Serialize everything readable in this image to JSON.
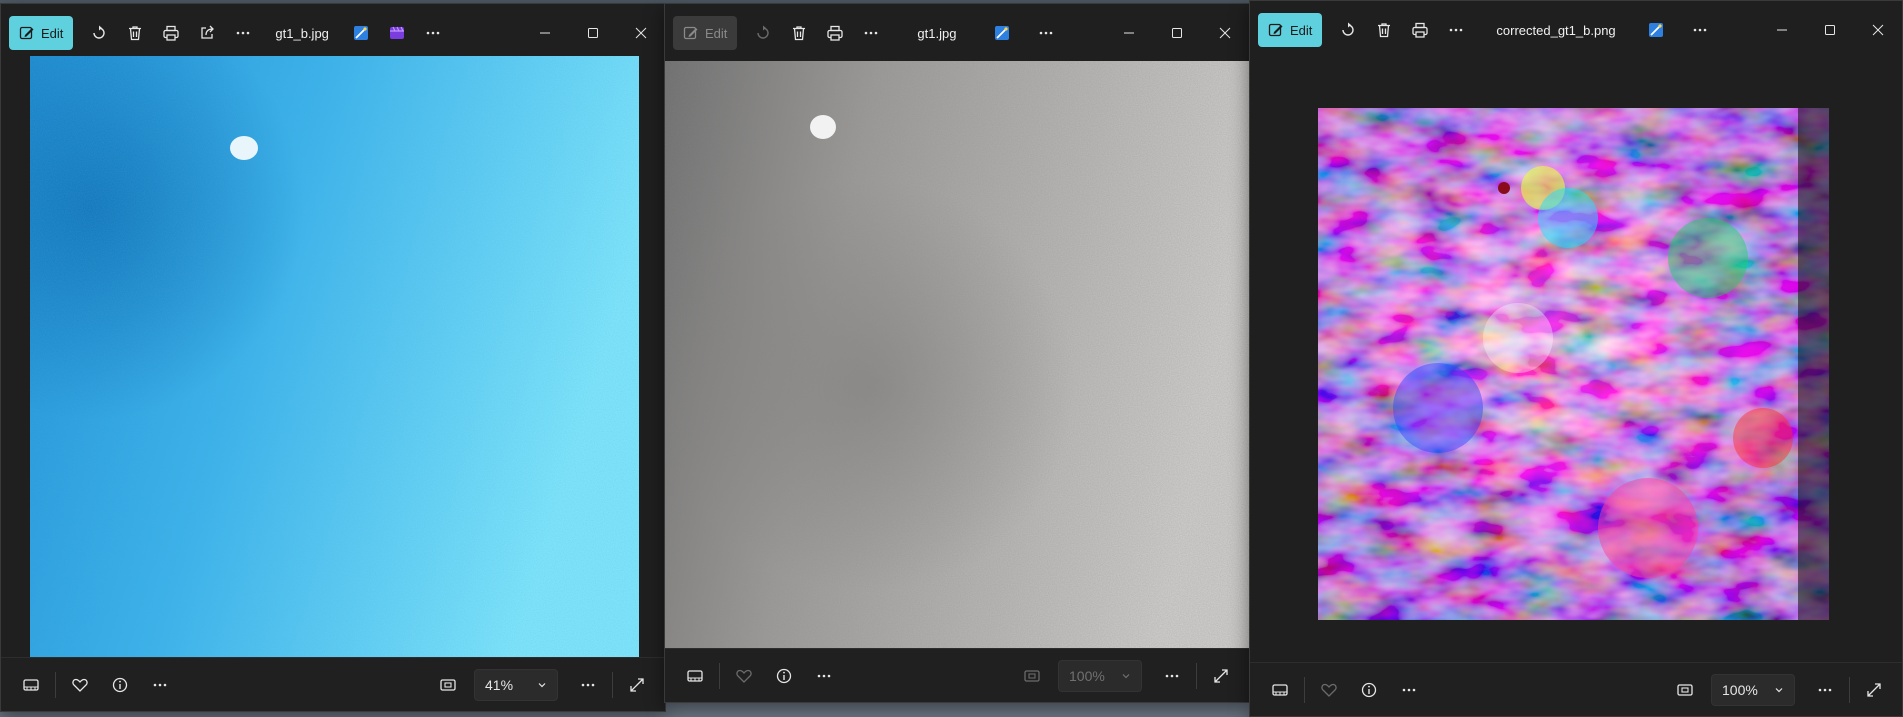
{
  "windows": [
    {
      "filename": "gt1_b.jpg",
      "edit_label": "Edit",
      "zoom": "41%",
      "image_description_key": "blue-concrete-texture"
    },
    {
      "filename": "gt1.jpg",
      "edit_label": "Edit",
      "zoom": "100%",
      "image_description_key": "gray-concrete-texture"
    },
    {
      "filename": "corrected_gt1_b.png",
      "edit_label": "Edit",
      "zoom": "100%",
      "image_description_key": "psychedelic-color-texture"
    }
  ],
  "colors": {
    "accent": "#5fd1de",
    "window_bg": "#1f1f1f"
  }
}
